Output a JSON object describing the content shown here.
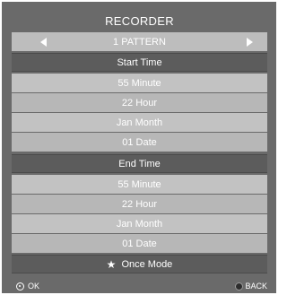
{
  "recorder": {
    "title": "RECORDER",
    "pattern": "1 PATTERN",
    "start_section": "Start Time",
    "start_minute": "55 Minute",
    "start_hour": "22 Hour",
    "start_month": "Jan Month",
    "start_date": "01 Date",
    "end_section": "End Time",
    "end_minute": "55 Minute",
    "end_hour": "22 Hour",
    "end_month": "Jan Month",
    "end_date": "01 Date",
    "mode": "Once Mode"
  },
  "footer": {
    "ok_label": "OK",
    "back_label": "BACK"
  },
  "icons": {
    "left": "chevron-left-icon",
    "right": "chevron-right-icon",
    "mode": "star-icon",
    "ok": "ok-circle-icon",
    "back": "back-dot-icon"
  }
}
